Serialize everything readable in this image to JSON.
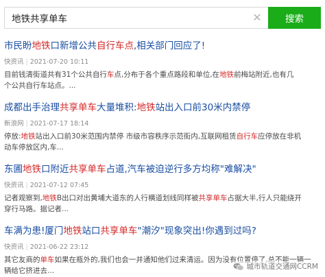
{
  "search": {
    "query": "地铁共享单车",
    "clear_icon": "close-icon",
    "button_label": "搜索",
    "accent_color": "#1aad19"
  },
  "results": [
    {
      "title": [
        {
          "t": "市民盼",
          "h": false
        },
        {
          "t": "地铁",
          "h": true
        },
        {
          "t": "口新增公共",
          "h": false
        },
        {
          "t": "自行车点",
          "h": true
        },
        {
          "t": ",相关部门回应了!",
          "h": false
        }
      ],
      "source": "快资讯",
      "date": "2021-07-20 10:11",
      "snippet": [
        {
          "t": "目前钱清街道共有31个公共自行",
          "h": false
        },
        {
          "t": "车",
          "h": true
        },
        {
          "t": "点,分布于各个重点路段和单位,在",
          "h": false
        },
        {
          "t": "地铁",
          "h": true
        },
        {
          "t": "前梅站附近,也有几个公共自行车站点。...",
          "h": false
        }
      ]
    },
    {
      "title": [
        {
          "t": "成都出手治理",
          "h": false
        },
        {
          "t": "共享单车",
          "h": true
        },
        {
          "t": "大量堆积:",
          "h": false
        },
        {
          "t": "地铁",
          "h": true
        },
        {
          "t": "站出入口前30米内禁停",
          "h": false
        }
      ],
      "source": "新浪网",
      "date": "2021-07-17 18:14",
      "snippet": [
        {
          "t": "停放:",
          "h": false
        },
        {
          "t": "地铁",
          "h": true
        },
        {
          "t": "站出入口前30米范围内禁停 市级市容秩序示范街内,互联网租赁",
          "h": false
        },
        {
          "t": "自行车",
          "h": true
        },
        {
          "t": "应停放在非机动车停放区内,车...",
          "h": false
        }
      ]
    },
    {
      "title": [
        {
          "t": "东圃",
          "h": false
        },
        {
          "t": "地铁",
          "h": true
        },
        {
          "t": "口附近",
          "h": false
        },
        {
          "t": "共享单车",
          "h": true
        },
        {
          "t": "占道,汽车被迫逆行多方均称\"难解决\"",
          "h": false
        }
      ],
      "source": "快资讯",
      "date": "2021-07-12 07:45",
      "snippet": [
        {
          "t": "记者观察到,",
          "h": false
        },
        {
          "t": "地铁",
          "h": true
        },
        {
          "t": "B出口对出黄埔大道东的人行横道划线同样被",
          "h": false
        },
        {
          "t": "共享单车",
          "h": true
        },
        {
          "t": "占据大半,行人只能绕开穿行马路。据记者...",
          "h": false
        }
      ]
    },
    {
      "title": [
        {
          "t": "车满为患!厦门",
          "h": false
        },
        {
          "t": "地铁",
          "h": true
        },
        {
          "t": "站口",
          "h": false
        },
        {
          "t": "共享单车",
          "h": true
        },
        {
          "t": "\"潮汐\"现象突出!你遇到过吗?",
          "h": false
        }
      ],
      "source": "快资讯",
      "date": "2021-06-22 23:12",
      "snippet": [
        {
          "t": "其它友商的",
          "h": false
        },
        {
          "t": "单车",
          "h": true
        },
        {
          "t": "如果在瓶外的,我们也会一并通知他们过来清运。因为没有位置停了,总不能一辆一辆给它挤进去...",
          "h": false
        }
      ]
    }
  ],
  "watermark": {
    "text": "城市轨道交通网CCRM",
    "icon": "wechat-icon"
  },
  "colors": {
    "link": "#1a4ea2",
    "highlight": "#d42a2a",
    "meta": "#8a8a8a"
  }
}
